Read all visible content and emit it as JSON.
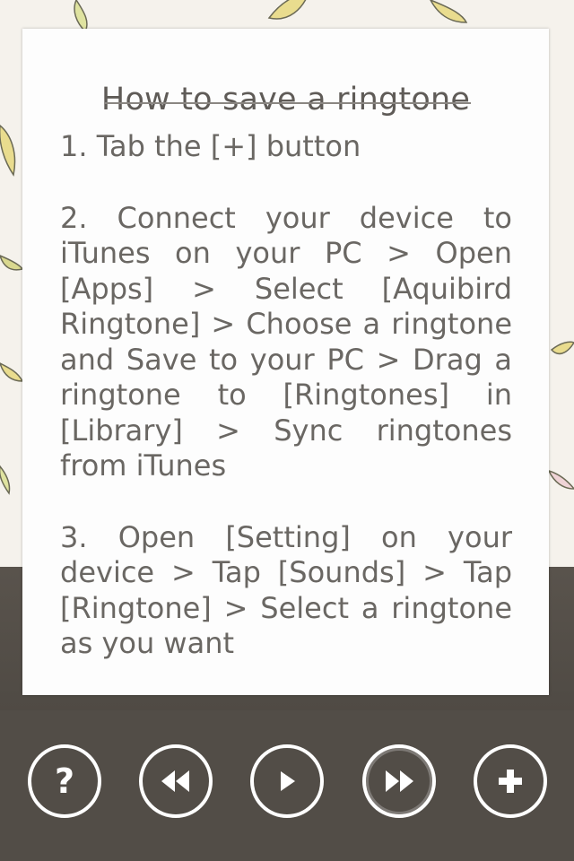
{
  "help_card": {
    "title": "How to save a ringtone",
    "steps": [
      "1. Tab the [+] button",
      "2. Connect your device to iTunes on your PC > Open [Apps] > Select [Aquibird Ringtone] > Choose a ringtone and Save to your PC > Drag a ringtone to [Ringtones] in [Library] > Sync ringtones from iTunes",
      "3. Open [Setting] on your device > Tap [Sounds] > Tap [Ringtone] > Select a ringtone as you want"
    ]
  },
  "toolbar": {
    "help_label": "?",
    "buttons": [
      "help-icon",
      "rewind-icon",
      "play-icon",
      "fast-forward-icon",
      "plus-icon"
    ]
  },
  "colors": {
    "background_dark": "#524d47",
    "card": "#fdfdfd",
    "text": "#6a6763",
    "icon": "#ffffff",
    "leaf_yellow": "#e8d98a",
    "leaf_green": "#c9d79a"
  }
}
